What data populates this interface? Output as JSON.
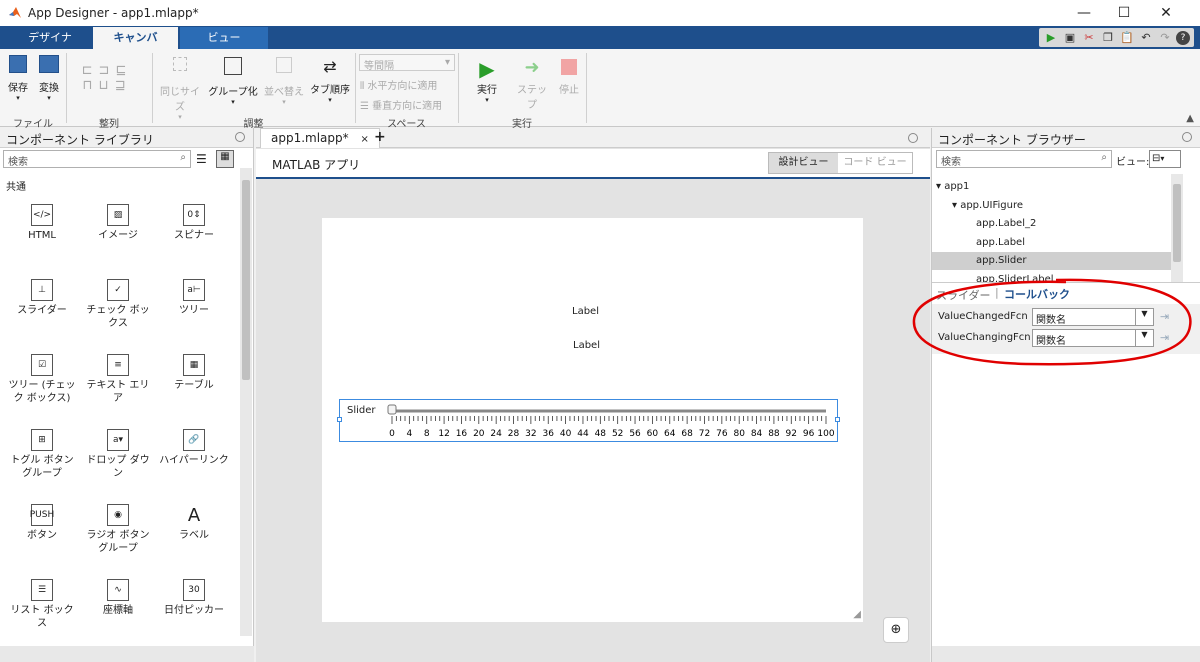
{
  "window": {
    "title": "App Designer - app1.mlapp*"
  },
  "ribbon_tabs": [
    "デザイナー",
    "キャンバス",
    "ビュー"
  ],
  "ribbon": {
    "file": {
      "save": "保存",
      "convert": "変換",
      "group": "ファイル"
    },
    "align": {
      "group": "整列"
    },
    "arrange": {
      "same_size": "同じサイズ",
      "group_btn": "グループ化",
      "reorder": "並べ替え",
      "tab_order": "タブ順序",
      "group": "調整"
    },
    "space": {
      "dropdown": "等間隔",
      "horiz": "水平方向に適用",
      "vert": "垂直方向に適用",
      "group": "スペース"
    },
    "run": {
      "run": "実行",
      "step": "ステップ",
      "stop": "停止",
      "group": "実行"
    }
  },
  "library": {
    "title": "コンポーネント ライブラリ",
    "search_placeholder": "検索",
    "section": "共通",
    "items": [
      {
        "label": "HTML",
        "icon": "html-icon"
      },
      {
        "label": "イメージ",
        "icon": "image-icon"
      },
      {
        "label": "スピナー",
        "icon": "spinner-icon"
      },
      {
        "label": "スライダー",
        "icon": "slider-icon"
      },
      {
        "label": "チェック ボックス",
        "icon": "checkbox-icon"
      },
      {
        "label": "ツリー",
        "icon": "tree-icon"
      },
      {
        "label": "ツリー (チェック ボックス)",
        "icon": "checkbox-tree-icon"
      },
      {
        "label": "テキスト エリア",
        "icon": "text-area-icon"
      },
      {
        "label": "テーブル",
        "icon": "table-icon"
      },
      {
        "label": "トグル ボタン グループ",
        "icon": "toggle-button-group-icon"
      },
      {
        "label": "ドロップ ダウン",
        "icon": "dropdown-icon"
      },
      {
        "label": "ハイパーリンク",
        "icon": "hyperlink-icon"
      },
      {
        "label": "ボタン",
        "icon": "push-button-icon"
      },
      {
        "label": "ラジオ ボタン グループ",
        "icon": "radio-button-group-icon"
      },
      {
        "label": "ラベル",
        "icon": "label-icon"
      },
      {
        "label": "リスト ボックス",
        "icon": "list-box-icon"
      },
      {
        "label": "座標軸",
        "icon": "axes-icon"
      },
      {
        "label": "日付ピッカー",
        "icon": "date-picker-icon"
      }
    ]
  },
  "editor": {
    "tab": "app1.mlapp*",
    "app_title": "MATLAB アプリ",
    "design_view": "設計ビュー",
    "code_view": "コード ビュー",
    "label1": "Label",
    "label2": "Label",
    "slider_label": "Slider",
    "slider_value": 0,
    "ticks": [
      "0",
      "4",
      "8",
      "12",
      "16",
      "20",
      "24",
      "28",
      "32",
      "36",
      "40",
      "44",
      "48",
      "52",
      "56",
      "60",
      "64",
      "68",
      "72",
      "76",
      "80",
      "84",
      "88",
      "92",
      "96",
      "100"
    ]
  },
  "browser": {
    "title": "コンポーネント ブラウザー",
    "search_placeholder": "検索",
    "view_label": "ビュー:",
    "tree": [
      "app1",
      "app.UIFigure",
      "app.Label_2",
      "app.Label",
      "app.Slider",
      "app.SliderLabel"
    ],
    "selected": "app.Slider",
    "tabs": [
      "スライダー",
      "コールバック"
    ],
    "callbacks": [
      {
        "name": "ValueChangedFcn",
        "value": "関数名"
      },
      {
        "name": "ValueChangingFcn",
        "value": "関数名"
      }
    ]
  },
  "colors": {
    "ribbon_blue": "#1e4f8c",
    "annotation_red": "#e00000",
    "selection_gray": "#cfcfcf",
    "slider_border": "#3c8be0"
  }
}
